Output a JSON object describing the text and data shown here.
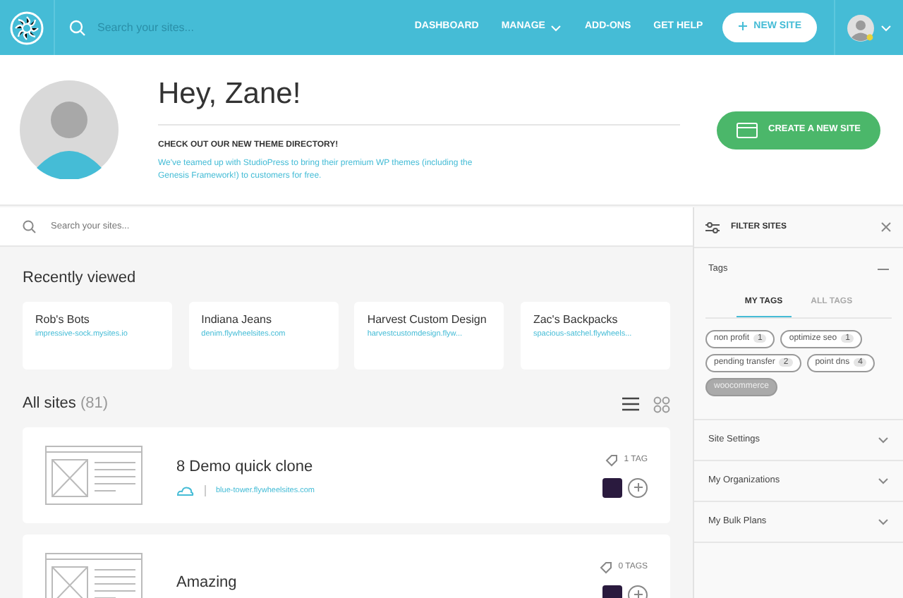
{
  "navbar": {
    "search_placeholder": "Search your sites...",
    "links": [
      {
        "label": "DASHBOARD",
        "dropdown": false
      },
      {
        "label": "MANAGE",
        "dropdown": true
      },
      {
        "label": "ADD-ONS",
        "dropdown": false
      },
      {
        "label": "GET HELP",
        "dropdown": false
      }
    ],
    "new_site_button": "NEW SITE"
  },
  "hero": {
    "greeting": "Hey, Zane!",
    "announcement_title": "CHECK OUT OUR NEW THEME DIRECTORY!",
    "announcement_text": "We've teamed up with StudioPress to bring their premium WP themes (including the Genesis Framework!) to customers for free.",
    "create_button": "CREATE A NEW SITE"
  },
  "site_search": {
    "placeholder": "Search your sites..."
  },
  "recently_viewed": {
    "title": "Recently viewed",
    "sites": [
      {
        "name": "Rob's Bots",
        "url": "impressive-sock.mysites.io"
      },
      {
        "name": "Indiana Jeans",
        "url": "denim.flywheelsites.com"
      },
      {
        "name": "Harvest Custom Design",
        "url": "harvestcustomdesign.flyw..."
      },
      {
        "name": "Zac's Backpacks",
        "url": "spacious-satchel.flywheels..."
      }
    ]
  },
  "all_sites": {
    "title": "All sites",
    "count": "(81)",
    "views": [
      {
        "kind": "list",
        "selected": true
      },
      {
        "kind": "grid",
        "selected": false
      }
    ],
    "sites": [
      {
        "name": "8 Demo quick clone",
        "url": "blue-tower.flywheelsites.com",
        "tags": "1 TAG"
      },
      {
        "name": "Amazing",
        "tags": "0 TAGS"
      }
    ]
  },
  "filter": {
    "title": "FILTER SITES",
    "sections": [
      {
        "label": "Tags",
        "expanded": true
      },
      {
        "label": "Site Settings",
        "expanded": false
      },
      {
        "label": "My Organizations",
        "expanded": false
      },
      {
        "label": "My Bulk Plans",
        "expanded": false
      }
    ],
    "tabs": [
      {
        "label": "MY TAGS",
        "selected": true
      },
      {
        "label": "ALL TAGS",
        "selected": false
      }
    ],
    "tags": [
      {
        "label": "non profit",
        "count": "1",
        "selected": false
      },
      {
        "label": "optimize seo",
        "count": "1",
        "selected": false
      },
      {
        "label": "pending transfer",
        "count": "2",
        "selected": false
      },
      {
        "label": "point dns",
        "count": "4",
        "selected": false
      },
      {
        "label": "woocommerce",
        "selected": true
      }
    ]
  }
}
